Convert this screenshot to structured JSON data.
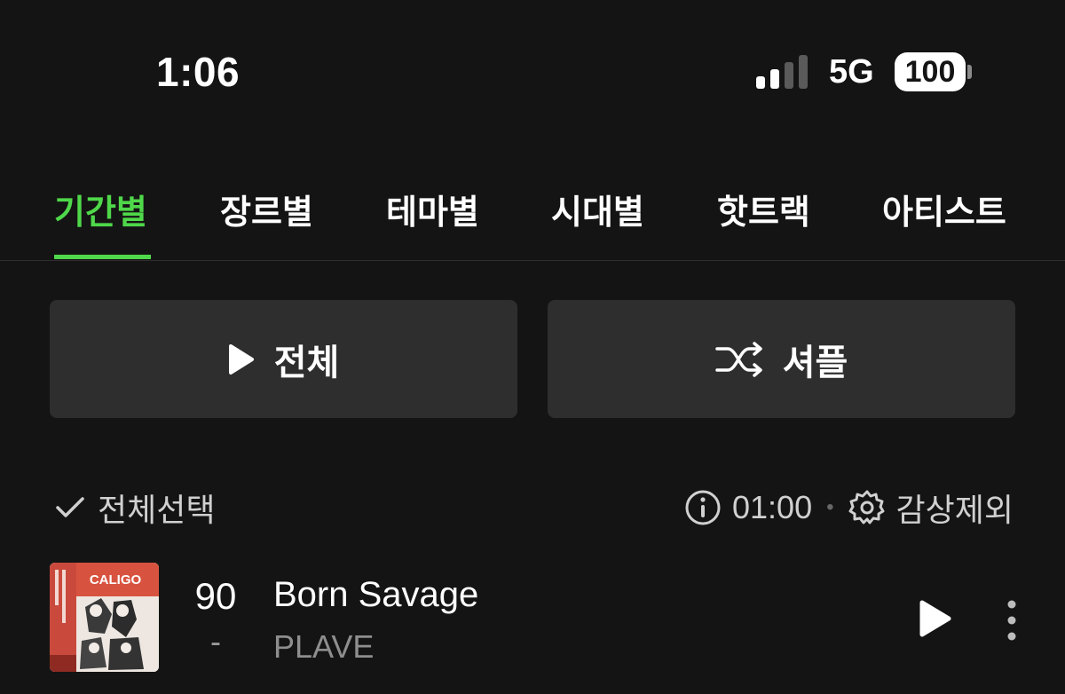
{
  "status": {
    "time": "1:06",
    "network": "5G",
    "battery": "100"
  },
  "tabs": [
    {
      "label": "기간별",
      "active": true
    },
    {
      "label": "장르별",
      "active": false
    },
    {
      "label": "테마별",
      "active": false
    },
    {
      "label": "시대별",
      "active": false
    },
    {
      "label": "핫트랙",
      "active": false
    },
    {
      "label": "아티스트",
      "active": false
    }
  ],
  "actions": {
    "play_all": "전체",
    "shuffle": "셔플"
  },
  "select_row": {
    "select_all": "전체선택",
    "time": "01:00",
    "exclude": "감상제외"
  },
  "tracks": [
    {
      "rank": "90",
      "change": "-",
      "title": "Born Savage",
      "artist": "PLAVE",
      "album_text": "CALIGO"
    }
  ],
  "colors": {
    "accent": "#4fd84a",
    "background": "#141414",
    "button": "#2e2e2e"
  }
}
